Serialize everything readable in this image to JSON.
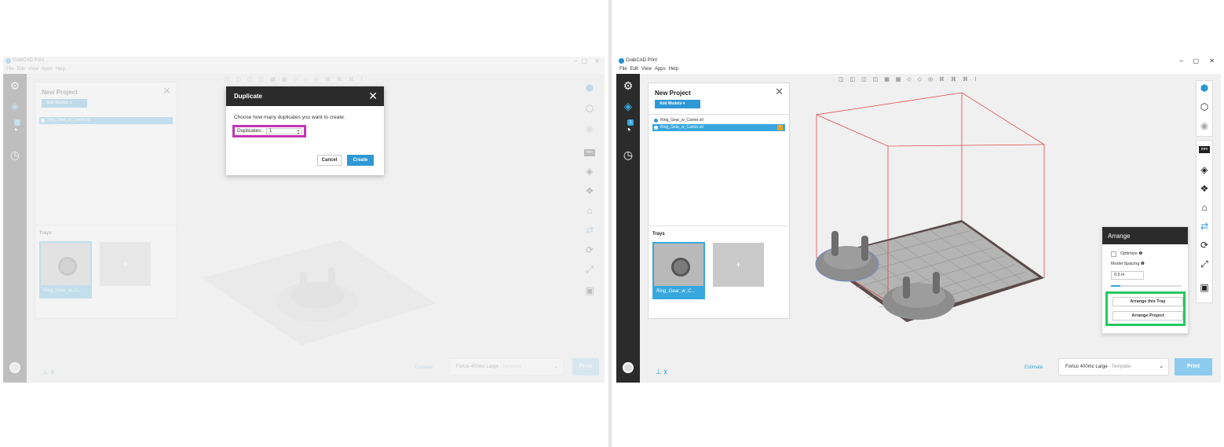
{
  "app": {
    "title": "GrabCAD Print",
    "menu": [
      "File",
      "Edit",
      "View",
      "Apps",
      "Help"
    ],
    "window_controls": [
      "–",
      "▢",
      "✕"
    ]
  },
  "project": {
    "title": "New Project",
    "add_models_label": "Add Models",
    "close_icon": "✕",
    "models": [
      "Ring_Gear_w_Carrier.stl",
      "Ring_Gear_w_Carrier.stl"
    ],
    "trays_title": "Trays",
    "tray_name": "Ring_Gear_w_C...",
    "tray_add": "+"
  },
  "toolbar": {
    "top_icons": "◫ ◫ ◫ ◫ ▦ ▦ ◇ ◇ ◎ ⌘ ⌘ ⌘ ⌇"
  },
  "sidebar": {
    "icons": [
      "add-model-icon",
      "models-icon",
      "history-queue-icon",
      "history-icon"
    ],
    "badge": "1"
  },
  "units_label": "mm",
  "bottom": {
    "estimate_label": "Estimate",
    "printer_name": "Fortus 400mc Large",
    "printer_template": "- Template",
    "print_label": "Print"
  },
  "duplicate_dialog": {
    "title": "Duplicate",
    "message": "Choose how many duplicates you want to create.",
    "field_label": "Duplicates:",
    "value": "1",
    "cancel_label": "Cancel",
    "create_label": "Create",
    "highlight_color": "#c435b1"
  },
  "arrange_panel": {
    "title": "Arrange",
    "optimize_label": "Optimize ❶",
    "spacing_label": "Model Spacing ❶",
    "spacing_value": "0.5 in",
    "arrange_tray_label": "Arrange this Tray",
    "arrange_project_label": "Arrange Project",
    "highlight_color": "#24c95f"
  },
  "colors": {
    "accent": "#2f97d4",
    "sidebar": "#2b2b2b",
    "build_volume": "#e04848"
  }
}
